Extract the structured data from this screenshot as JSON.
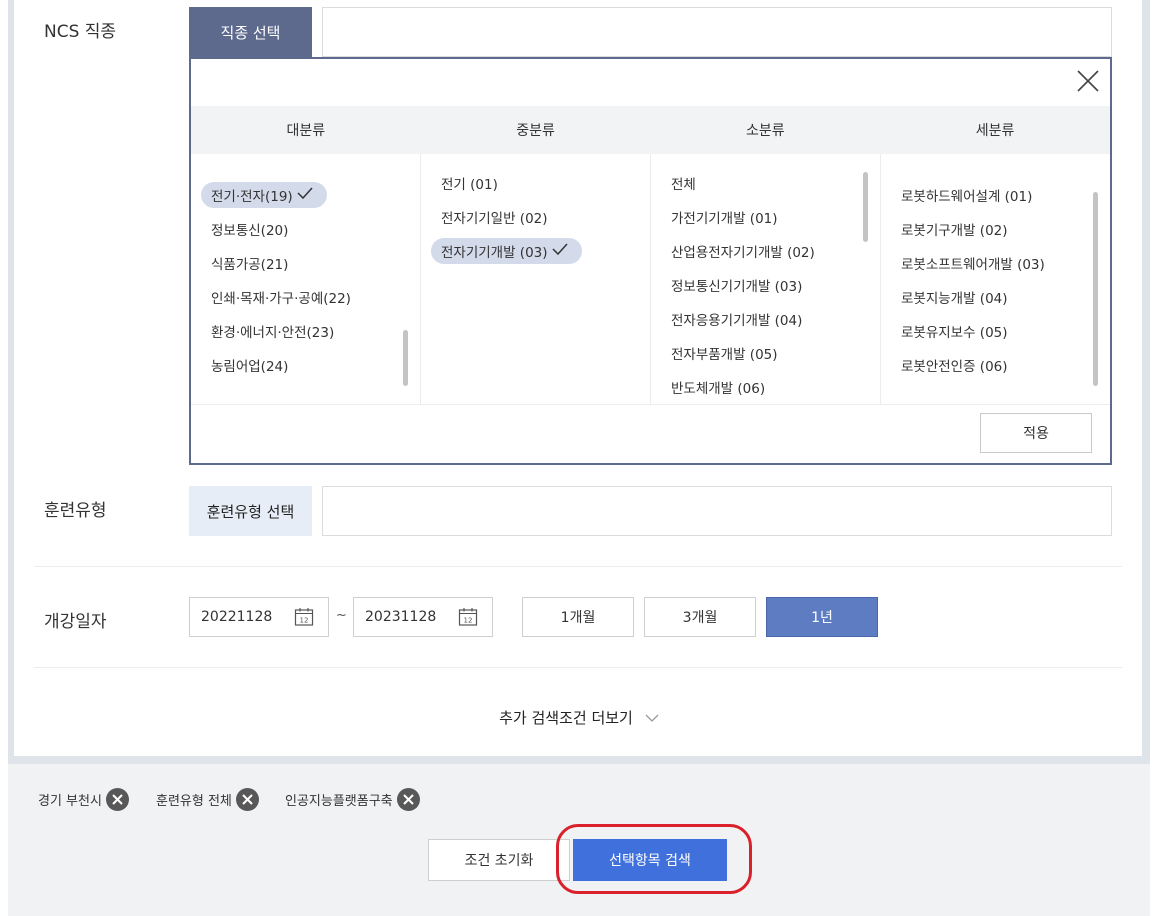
{
  "labels": {
    "ncs": "NCS 직종",
    "training": "훈련유형",
    "date": "개강일자"
  },
  "ncs": {
    "select_button": "직종 선택",
    "columns": [
      "대분류",
      "중분류",
      "소분류",
      "세분류"
    ],
    "major": [
      {
        "label": "전기·전자(19)",
        "selected": true
      },
      {
        "label": "정보통신(20)",
        "selected": false
      },
      {
        "label": "식품가공(21)",
        "selected": false
      },
      {
        "label": "인쇄·목재·가구·공예(22)",
        "selected": false
      },
      {
        "label": "환경·에너지·안전(23)",
        "selected": false
      },
      {
        "label": "농림어업(24)",
        "selected": false
      }
    ],
    "middle": [
      {
        "label": "전기 (01)",
        "selected": false
      },
      {
        "label": "전자기기일반 (02)",
        "selected": false
      },
      {
        "label": "전자기기개발 (03)",
        "selected": true
      }
    ],
    "minor": [
      {
        "label": "전체",
        "selected": false
      },
      {
        "label": "가전기기개발 (01)",
        "selected": false
      },
      {
        "label": "산업용전자기기개발 (02)",
        "selected": false
      },
      {
        "label": "정보통신기기개발 (03)",
        "selected": false
      },
      {
        "label": "전자응용기기개발 (04)",
        "selected": false
      },
      {
        "label": "전자부품개발 (05)",
        "selected": false
      },
      {
        "label": "반도체개발 (06)",
        "selected": false
      }
    ],
    "detail": [
      {
        "label": "로봇하드웨어설계 (01)",
        "selected": false
      },
      {
        "label": "로봇기구개발 (02)",
        "selected": false
      },
      {
        "label": "로봇소프트웨어개발 (03)",
        "selected": false
      },
      {
        "label": "로봇지능개발 (04)",
        "selected": false
      },
      {
        "label": "로봇유지보수 (05)",
        "selected": false
      },
      {
        "label": "로봇안전인증 (06)",
        "selected": false
      }
    ],
    "apply_button": "적용"
  },
  "training": {
    "select_button": "훈련유형 선택"
  },
  "dates": {
    "start": "20221128",
    "end": "20231128",
    "separator": "~",
    "calendar_day": "12",
    "periods": [
      {
        "label": "1개월",
        "active": false
      },
      {
        "label": "3개월",
        "active": false
      },
      {
        "label": "1년",
        "active": true
      }
    ]
  },
  "more_conditions": "추가 검색조건 더보기",
  "chips": [
    "경기 부천시",
    "훈련유형 전체",
    "인공지능플랫폼구축"
  ],
  "actions": {
    "reset": "조건 초기화",
    "search": "선택항목 검색"
  },
  "colors": {
    "accent": "#5d6a8e",
    "active_period": "#5e7cc1",
    "search_button": "#4070dc",
    "highlight": "#d9202b",
    "selected_pill": "#d3daea"
  }
}
